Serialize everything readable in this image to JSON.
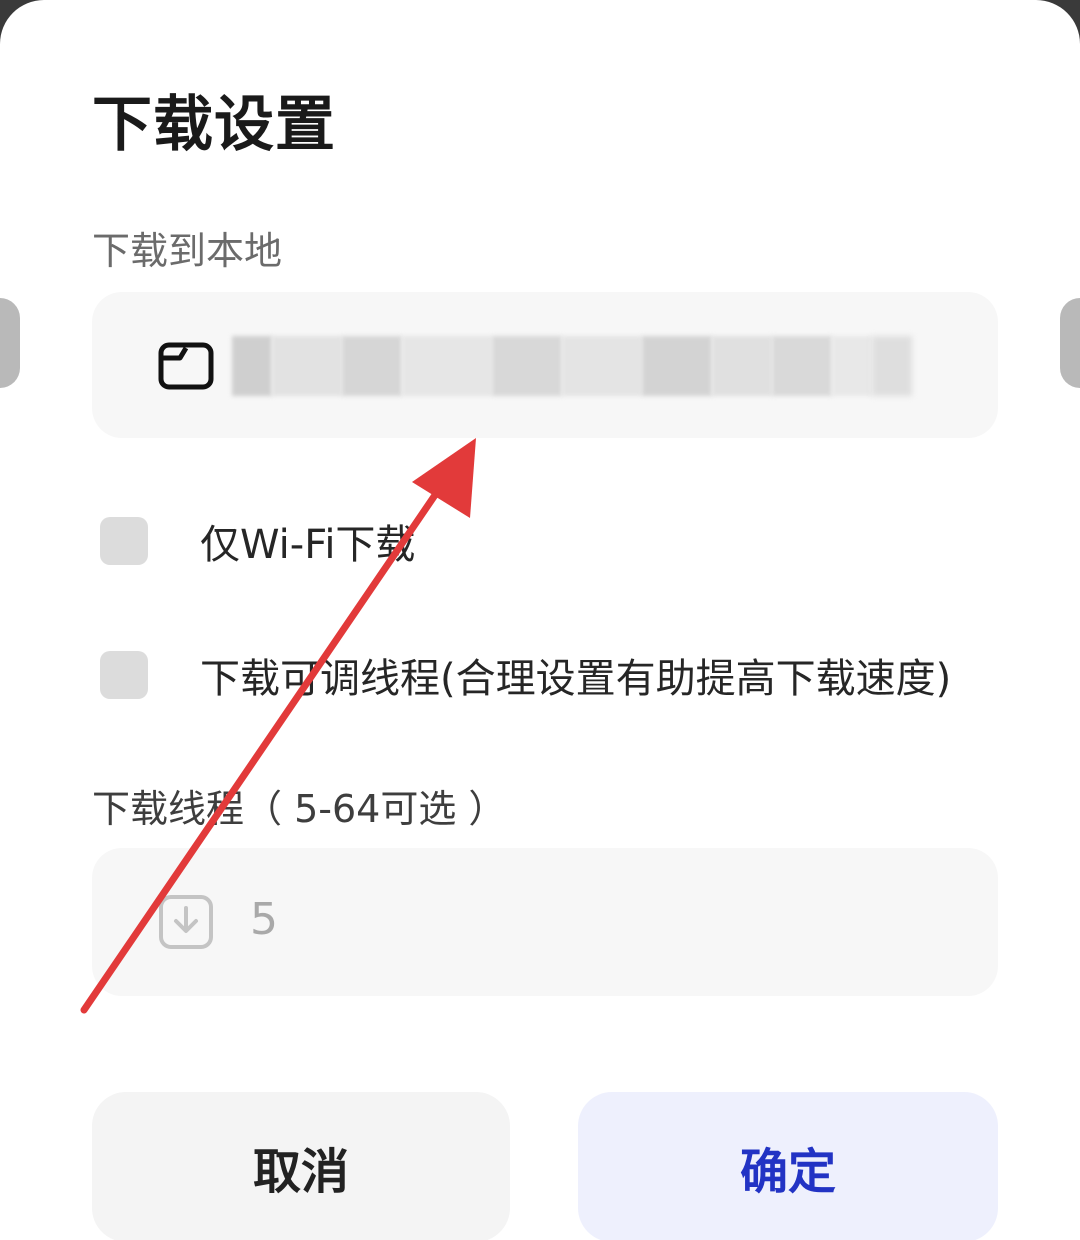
{
  "dialog": {
    "title": "下载设置",
    "local_section_label": "下载到本地",
    "download_path_value": "",
    "wifi_only": {
      "label": "仅Wi-Fi下载",
      "checked": false
    },
    "adjustable_threads": {
      "label": "下载可调线程(合理设置有助提高下载速度)",
      "checked": false
    },
    "threads_section_label": "下载线程（ 5-64可选 ）",
    "thread_value": "5",
    "cancel_label": "取消",
    "confirm_label": "确定"
  },
  "icons": {
    "path": "folder-icon",
    "threads": "download-icon"
  },
  "colors": {
    "confirm_text": "#2233c4",
    "confirm_bg": "#eef0fd",
    "annotation_arrow": "#e23a3a"
  }
}
